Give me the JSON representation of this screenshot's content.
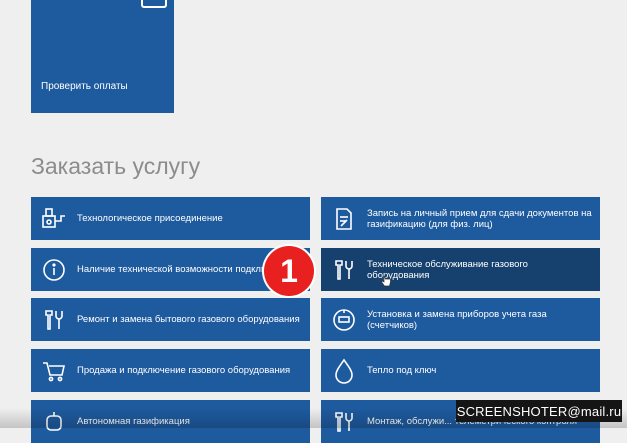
{
  "top_tile": {
    "label": "Проверить оплаты",
    "icon": "document-icon"
  },
  "section_title": "Заказать услугу",
  "services_left": [
    {
      "label": "Технологическое присоединение",
      "icon": "connection-icon"
    },
    {
      "label": "Наличие технической возможности подключения",
      "icon": "info-icon"
    },
    {
      "label": "Ремонт и замена бытового газового оборудования",
      "icon": "tools-icon"
    },
    {
      "label": "Продажа и подключение газового оборудования",
      "icon": "cart-icon"
    },
    {
      "label": "Автономная газификация",
      "icon": "tank-icon"
    }
  ],
  "services_right": [
    {
      "label": "Запись на личный прием для сдачи документов на газификацию (для физ. лиц)",
      "icon": "form-icon"
    },
    {
      "label": "Техническое обслуживание газового оборудования",
      "icon": "tools-icon"
    },
    {
      "label": "Установка и замена приборов учета газа (счетчиков)",
      "icon": "meter-icon"
    },
    {
      "label": "Тепло под ключ",
      "icon": "flame-icon"
    },
    {
      "label": "Монтаж, обслужи... телеметрического контроля",
      "icon": "tools-icon"
    }
  ],
  "step_badge": "1",
  "watermark": "SCREENSHOTER@mail.ru",
  "colors": {
    "tile": "#1e5a9e",
    "tile_active": "#16416f",
    "badge": "#e8201f",
    "background": "#efefef"
  }
}
